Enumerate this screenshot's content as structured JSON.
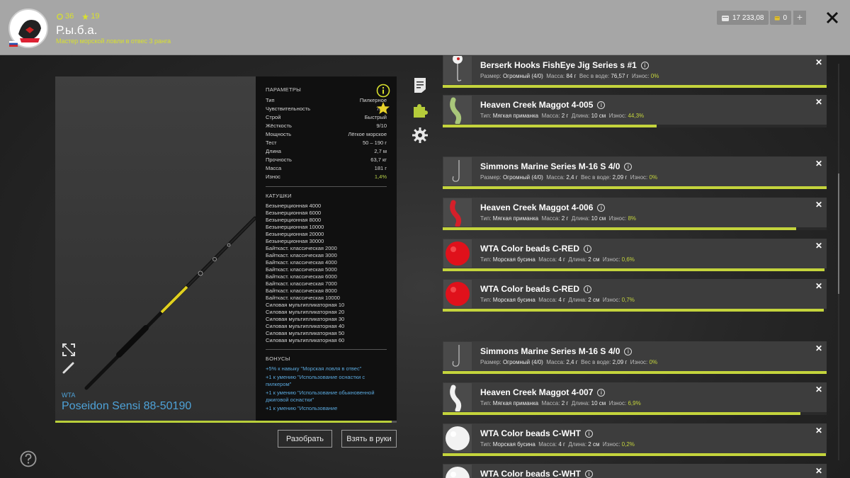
{
  "header": {
    "level": "36",
    "stars": "19",
    "player_name": "Р.ы.б.а.",
    "player_rank": "Мастер морской ловли в отвес 3 ранга",
    "silver": "17 233,08",
    "gold": "0",
    "plus": "+"
  },
  "rod": {
    "brand": "WTA",
    "name": "Poseidon Sensi 88-50190",
    "wear_fraction": 0.986
  },
  "params": {
    "section_title": "ПАРАМЕТРЫ",
    "rows": [
      {
        "k": "Тип",
        "v": "Пилкерное"
      },
      {
        "k": "Чувствительность",
        "v": "7/10"
      },
      {
        "k": "Строй",
        "v": "Быстрый"
      },
      {
        "k": "Жёсткость",
        "v": "9/10"
      },
      {
        "k": "Мощность",
        "v": "Лёгкое морское"
      },
      {
        "k": "Тест",
        "v": "50 – 190 г"
      },
      {
        "k": "Длина",
        "v": "2,7 м"
      },
      {
        "k": "Прочность",
        "v": "63,7 кг"
      },
      {
        "k": "Масса",
        "v": "181 г"
      },
      {
        "k": "Износ",
        "v": "1,4%"
      }
    ],
    "reels_title": "КАТУШКИ",
    "reels": [
      "Безынерционная 4000",
      "Безынерционная 6000",
      "Безынерционная 8000",
      "Безынерционная 10000",
      "Безынерционная 20000",
      "Безынерционная 30000",
      "Байткаст. классическая 2000",
      "Байткаст. классическая 3000",
      "Байткаст. классическая 4000",
      "Байткаст. классическая 5000",
      "Байткаст. классическая 6000",
      "Байткаст. классическая 7000",
      "Байткаст. классическая 8000",
      "Байткаст. классическая 10000",
      "Силовая мультипликаторная 10",
      "Силовая мультипликаторная 20",
      "Силовая мультипликаторная 30",
      "Силовая мультипликаторная 40",
      "Силовая мультипликаторная 50",
      "Силовая мультипликаторная 60"
    ],
    "bonus_title": "БОНУСЫ",
    "bonuses": [
      "+5% к навыку \"Морская ловля в отвес\"",
      "+1 к умению \"Использование оснастки с пилкером\"",
      "+1 к умению \"Использование обыкновенной джиговой оснастки\"",
      "+1 к умению \"Использование"
    ]
  },
  "buttons": {
    "disassemble": "Разобрать",
    "take": "Взять в руки"
  },
  "items": [
    {
      "title": "Berserk Hooks FishEye Jig Series s #1",
      "k1": "Размер:",
      "v1": "Огромный (4/0)",
      "k2": "Масса:",
      "v2": "84 г",
      "k3": "Вес в воде:",
      "v3": "76,57 г",
      "k4": "Износ:",
      "wear": "0%",
      "fill": 1.0,
      "thumb": "jig"
    },
    {
      "title": "Heaven Creek Maggot 4-005",
      "k1": "Тип:",
      "v1": "Мягкая приманка",
      "k2": "Масса:",
      "v2": "2 г",
      "k3": "Длина:",
      "v3": "10 см",
      "k4": "Износ:",
      "wear": "44,3%",
      "fill": 0.557,
      "thumb": "maggot-green"
    },
    {
      "title": "Simmons Marine Series M-16 S 4/0",
      "k1": "Размер:",
      "v1": "Огромный (4/0)",
      "k2": "Масса:",
      "v2": "2,4 г",
      "k3": "Вес в воде:",
      "v3": "2,09 г",
      "k4": "Износ:",
      "wear": "0%",
      "fill": 1.0,
      "thumb": "hook"
    },
    {
      "title": "Heaven Creek Maggot 4-006",
      "k1": "Тип:",
      "v1": "Мягкая приманка",
      "k2": "Масса:",
      "v2": "2 г",
      "k3": "Длина:",
      "v3": "10 см",
      "k4": "Износ:",
      "wear": "8%",
      "fill": 0.92,
      "thumb": "maggot-red"
    },
    {
      "title": "WTA Color beads C-RED",
      "k1": "Тип:",
      "v1": "Морская бусина",
      "k2": "Масса:",
      "v2": "4 г",
      "k3": "Длина:",
      "v3": "2 см",
      "k4": "Износ:",
      "wear": "0,6%",
      "fill": 0.994,
      "thumb": "bead-red"
    },
    {
      "title": "WTA Color beads C-RED",
      "k1": "Тип:",
      "v1": "Морская бусина",
      "k2": "Масса:",
      "v2": "4 г",
      "k3": "Длина:",
      "v3": "2 см",
      "k4": "Износ:",
      "wear": "0,7%",
      "fill": 0.993,
      "thumb": "bead-red"
    },
    {
      "title": "Simmons Marine Series M-16 S 4/0",
      "k1": "Размер:",
      "v1": "Огромный (4/0)",
      "k2": "Масса:",
      "v2": "2,4 г",
      "k3": "Вес в воде:",
      "v3": "2,09 г",
      "k4": "Износ:",
      "wear": "0%",
      "fill": 1.0,
      "thumb": "hook"
    },
    {
      "title": "Heaven Creek Maggot 4-007",
      "k1": "Тип:",
      "v1": "Мягкая приманка",
      "k2": "Масса:",
      "v2": "2 г",
      "k3": "Длина:",
      "v3": "10 см",
      "k4": "Износ:",
      "wear": "6,9%",
      "fill": 0.931,
      "thumb": "maggot-white"
    },
    {
      "title": "WTA Color beads C-WHT",
      "k1": "Тип:",
      "v1": "Морская бусина",
      "k2": "Масса:",
      "v2": "4 г",
      "k3": "Длина:",
      "v3": "2 см",
      "k4": "Износ:",
      "wear": "0,2%",
      "fill": 0.998,
      "thumb": "bead-white"
    },
    {
      "title": "WTA Color beads C-WHT",
      "k1": "",
      "v1": "",
      "k2": "",
      "v2": "",
      "k3": "",
      "v3": "",
      "k4": "",
      "wear": "",
      "fill": 1.0,
      "thumb": "bead-white"
    }
  ],
  "colors": {
    "accent_green": "#c4d43c",
    "link_blue": "#4ea2d8",
    "header_bg": "#a6a6a6"
  }
}
